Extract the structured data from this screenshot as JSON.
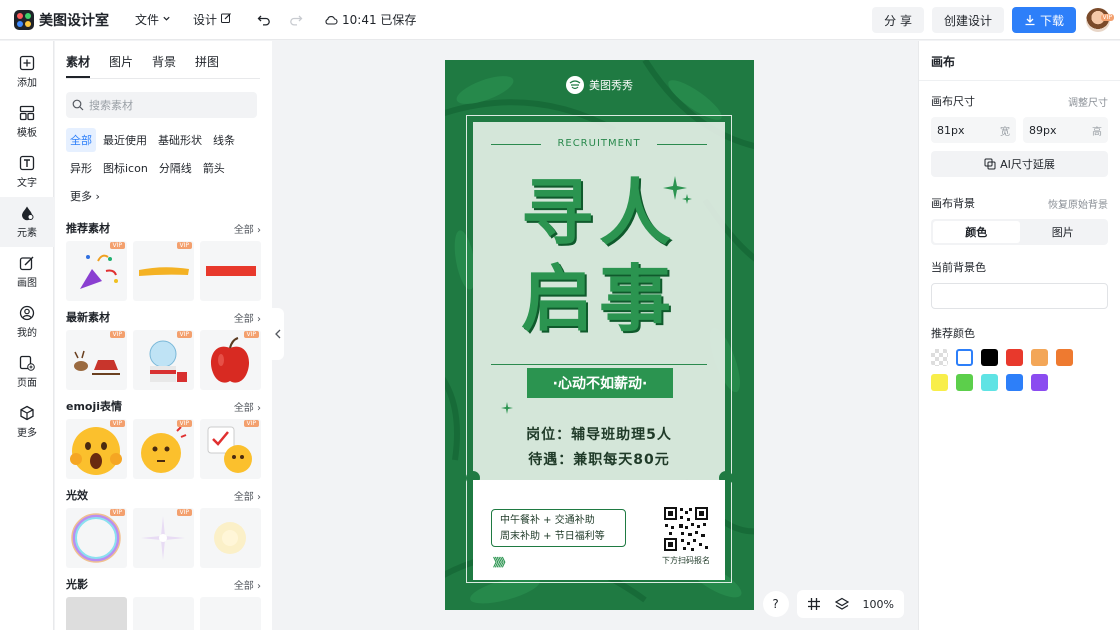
{
  "app": {
    "name": "美图设计室"
  },
  "menu": {
    "file": "文件",
    "design": "设计",
    "save_status": "10:41 已保存"
  },
  "actions": {
    "share": "分 享",
    "create": "创建设计",
    "download": "下载"
  },
  "user": {
    "vip": "VIP"
  },
  "rail": [
    {
      "label": "添加",
      "icon": "plus-square-icon"
    },
    {
      "label": "模板",
      "icon": "template-icon"
    },
    {
      "label": "文字",
      "icon": "text-icon"
    },
    {
      "label": "元素",
      "icon": "shapes-icon",
      "active": true
    },
    {
      "label": "画图",
      "icon": "pen-icon"
    },
    {
      "label": "我的",
      "icon": "user-icon"
    },
    {
      "label": "页面",
      "icon": "page-add-icon"
    },
    {
      "label": "更多",
      "icon": "cube-icon"
    }
  ],
  "panel": {
    "tabs": [
      "素材",
      "图片",
      "背景",
      "拼图"
    ],
    "search_placeholder": "搜索素材",
    "chips": [
      "全部",
      "最近使用",
      "基础形状",
      "线条",
      "异形",
      "图标icon",
      "分隔线",
      "箭头",
      "更多"
    ],
    "all_label": "全部",
    "vip_label": "VIP",
    "sections": [
      {
        "title": "推荐素材"
      },
      {
        "title": "最新素材"
      },
      {
        "title": "emoji表情"
      },
      {
        "title": "光效"
      },
      {
        "title": "光影"
      }
    ]
  },
  "poster": {
    "brand": "美图秀秀",
    "tag": "RECRUITMENT",
    "headline_1": "寻人",
    "headline_2": "启事",
    "slogan": "·心动不如薪动·",
    "job_1": "岗位：辅导班助理5人",
    "job_2": "待遇：兼职每天80元",
    "benefit_1": "中午餐补 + 交通补助",
    "benefit_2": "周末补助 + 节日福利等",
    "arrows": "》》》",
    "qr_label": "下方扫码报名",
    "colors": {
      "green": "#1f7a42",
      "accent": "#2b9450"
    }
  },
  "canvas_tools": {
    "help": "?",
    "zoom": "100%"
  },
  "right": {
    "title": "画布",
    "size_label": "画布尺寸",
    "adjust_size": "调整尺寸",
    "width_value": "81px",
    "width_unit": "宽",
    "height_value": "89px",
    "height_unit": "高",
    "ai_extend": "AI尺寸延展",
    "bg_label": "画布背景",
    "restore_bg": "恢复原始背景",
    "seg_color": "颜色",
    "seg_image": "图片",
    "current_bg": "当前背景色",
    "recommend": "推荐颜色",
    "swatches": [
      "transparent",
      "#ffffff",
      "#000000",
      "#e8392c",
      "#f3a657",
      "#ee7a30",
      "#f8ee4a",
      "#5ccf4b",
      "#5fe3e4",
      "#2d7ff9",
      "#8b4cf0"
    ]
  }
}
